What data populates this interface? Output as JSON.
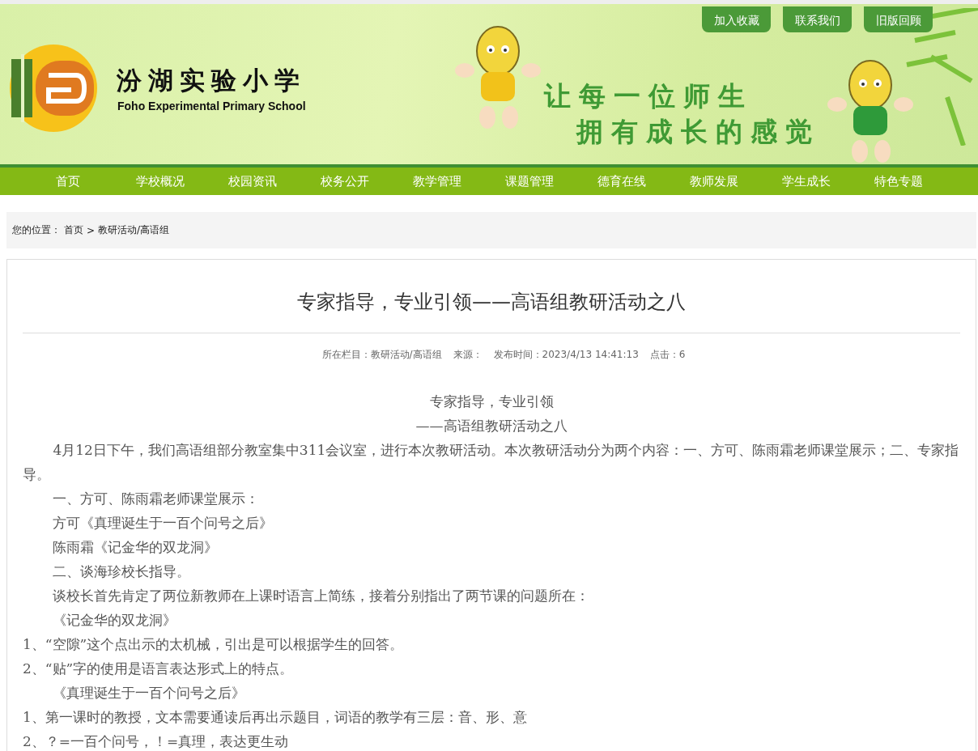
{
  "header": {
    "school_name": "汾湖实验小学",
    "school_name_en": "Foho Experimental Primary School",
    "slogan": [
      "让每一位师生",
      "拥有成长的感觉"
    ],
    "top_links": [
      "加入收藏",
      "联系我们",
      "旧版回顾"
    ]
  },
  "nav": [
    "首页",
    "学校概况",
    "校园资讯",
    "校务公开",
    "教学管理",
    "课题管理",
    "德育在线",
    "教师发展",
    "学生成长",
    "特色专题"
  ],
  "breadcrumb": {
    "label": "您的位置：",
    "items": [
      "首页",
      "教研活动/高语组"
    ],
    "separator": ">"
  },
  "article": {
    "title": "专家指导，专业引领——高语组教研活动之八",
    "meta": [
      "所在栏目：教研活动/高语组",
      "来源：",
      "发布时间：2023/4/13 14:41:13",
      "点击：6"
    ],
    "paragraphs": [
      {
        "kind": "center",
        "text": "专家指导，专业引领"
      },
      {
        "kind": "center",
        "text": "——高语组教研活动之八"
      },
      {
        "kind": "indent",
        "text": "4月12日下午，我们高语组部分教室集中311会议室，进行本次教研活动。本次教研活动分为两个内容：一、方可、陈雨霜老师课堂展示；二、专家指导。"
      },
      {
        "kind": "indent",
        "text": "一、方可、陈雨霜老师课堂展示："
      },
      {
        "kind": "indent",
        "text": "方可《真理诞生于一百个问号之后》"
      },
      {
        "kind": "indent",
        "text": "陈雨霜《记金华的双龙洞》"
      },
      {
        "kind": "indent",
        "text": "二、谈海珍校长指导。"
      },
      {
        "kind": "indent",
        "text": "谈校长首先肯定了两位新教师在上课时语言上简练，接着分别指出了两节课的问题所在："
      },
      {
        "kind": "indent",
        "text": "《记金华的双龙洞》"
      },
      {
        "kind": "plain",
        "text": "1、“空隙”这个点出示的太机械，引出是可以根据学生的回答。"
      },
      {
        "kind": "plain",
        "text": "2、“贴”字的使用是语言表达形式上的特点。"
      },
      {
        "kind": "indent",
        "text": "《真理诞生于一百个问号之后》"
      },
      {
        "kind": "plain",
        "text": "1、第一课时的教授，文本需要通读后再出示题目，词语的教学有三层：音、形、意"
      },
      {
        "kind": "plain",
        "text": "2、？=一百个问号，！=真理，表达更生动"
      }
    ]
  }
}
